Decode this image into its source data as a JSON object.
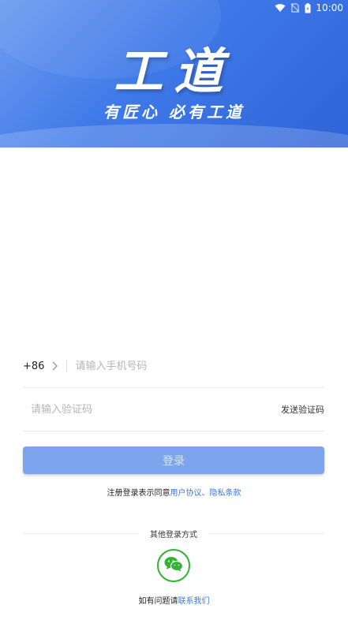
{
  "status_bar": {
    "time": "10:00",
    "icons": [
      "wifi-icon",
      "no-sim-icon",
      "battery-icon"
    ]
  },
  "header": {
    "logo_title": "工道",
    "slogan": "有匠心  必有工道"
  },
  "form": {
    "country_code": "+86",
    "phone_placeholder": "请输入手机号码",
    "code_placeholder": "请输入验证码",
    "send_code_label": "发送验证码",
    "login_label": "登录"
  },
  "agreement": {
    "prefix": "注册登录表示同意",
    "user_agreement": "用户协议",
    "separator": "、",
    "privacy_policy": "隐私条款"
  },
  "other_login": {
    "label": "其他登录方式",
    "options": [
      "wechat-icon"
    ]
  },
  "contact": {
    "prefix": "如有问题请",
    "link": "联系我们"
  },
  "colors": {
    "brand_blue": "#3f79e8",
    "button_blue": "#7da5ee",
    "link_blue": "#3d78e6",
    "wechat_green": "#2fb52e"
  }
}
